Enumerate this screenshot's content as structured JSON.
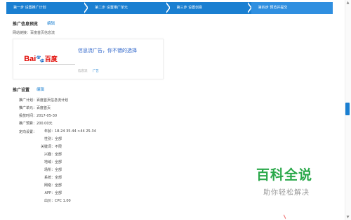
{
  "steps": [
    {
      "label": "第一步 设置推广计划"
    },
    {
      "label": "第二步 设置推广单元"
    },
    {
      "label": "第三步 设置创意"
    },
    {
      "label": "第四步 预览并提交"
    }
  ],
  "preview": {
    "title": "推广信息预览",
    "edit_label": "编辑",
    "url_label": "网站链接：百度首页信息流",
    "ad_headline": "信息流广告，你不错的选择",
    "source_label": "信息流",
    "ad_tag": "广告",
    "logo": {
      "bai": "Bai",
      "paw": "🐾",
      "du": "百度"
    }
  },
  "settings": {
    "title": "推广设置",
    "edit_label": "编辑",
    "rows": [
      {
        "label": "推广计划：",
        "value": "百度首页信息流计划"
      },
      {
        "label": "推广单元：",
        "value": "百度首页"
      },
      {
        "label": "投放时间：",
        "value": "2017-05-30"
      },
      {
        "label": "推广预算：",
        "value": "200.00元"
      }
    ],
    "targeting_label": "定向设置：",
    "targeting": [
      {
        "label": "年龄：",
        "value": "18-24 35-44 >44 25-34"
      },
      {
        "label": "性别：",
        "value": "全部"
      },
      {
        "label": "关键词：",
        "value": "不限"
      },
      {
        "label": "兴趣：",
        "value": "全部"
      },
      {
        "label": "地域：",
        "value": "全部"
      },
      {
        "label": "场所：",
        "value": "全部"
      },
      {
        "label": "系统：",
        "value": "全部"
      },
      {
        "label": "网络：",
        "value": "全部"
      },
      {
        "label": "APP：",
        "value": "全部"
      },
      {
        "label": "出价：",
        "value": "CPC 1.00"
      }
    ]
  },
  "watermark": {
    "title": "百科全说",
    "subtitle": "助你轻松解决"
  },
  "colors": {
    "primary": "#1a7fd1",
    "link": "#2a62c9",
    "watermark": "#2aa84a"
  }
}
